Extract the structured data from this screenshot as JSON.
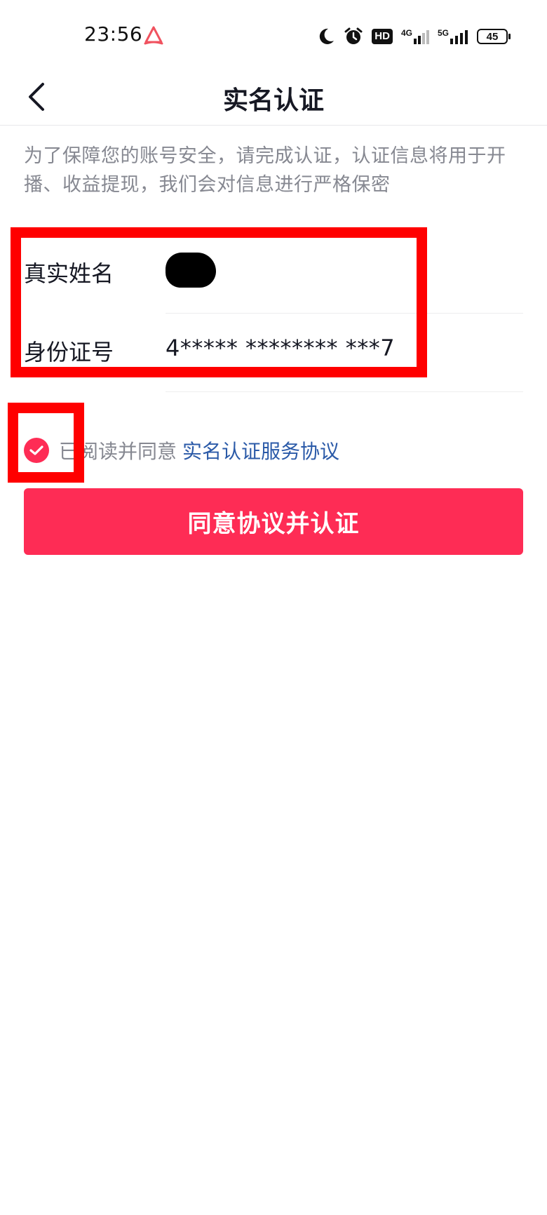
{
  "status_bar": {
    "time": "23:56",
    "hd_label": "HD",
    "net1_label": "4G",
    "net2_label": "5G",
    "battery_level": "45",
    "icons": [
      "app-logo-icon",
      "moon-icon",
      "alarm-icon",
      "signal-icon",
      "battery-icon"
    ]
  },
  "header": {
    "title": "实名认证"
  },
  "description": "为了保障您的账号安全，请完成认证，认证信息将用于开播、收益提现，我们会对信息进行严格保密",
  "form": {
    "name_label": "真实姓名",
    "id_label": "身份证号",
    "id_value": "4***** ******** ***7"
  },
  "agreement": {
    "checked": true,
    "text": "已阅读并同意",
    "link_text": "实名认证服务协议"
  },
  "primary_button": {
    "label": "同意协议并认证"
  },
  "colors": {
    "accent": "#fe2c55",
    "link": "#2b5aa8",
    "annotation": "#ff0000",
    "secondary_text": "#868891"
  }
}
